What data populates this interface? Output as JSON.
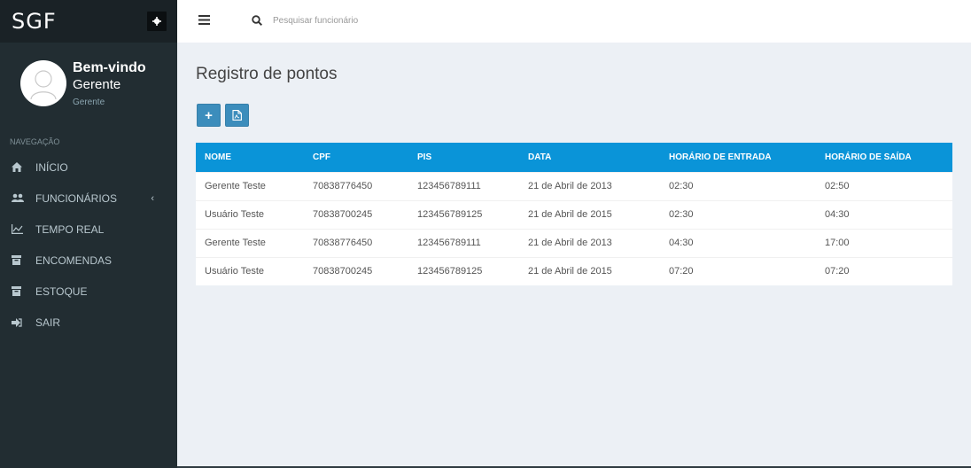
{
  "brand": {
    "name": "SGF"
  },
  "user_panel": {
    "welcome": "Bem-vindo",
    "name": "Gerente",
    "role": "Gerente"
  },
  "nav": {
    "header": "NAVEGAÇÃO",
    "items": [
      {
        "label": "INÍCIO",
        "icon": "home-icon"
      },
      {
        "label": "FUNCIONÁRIOS",
        "icon": "users-icon",
        "chevron": "‹"
      },
      {
        "label": "TEMPO REAL",
        "icon": "line-chart-icon"
      },
      {
        "label": "ENCOMENDAS",
        "icon": "box-icon"
      },
      {
        "label": "ESTOQUE",
        "icon": "box-icon"
      },
      {
        "label": "SAIR",
        "icon": "sign-out-icon"
      }
    ]
  },
  "search": {
    "placeholder": "Pesquisar funcionário"
  },
  "page": {
    "title": "Registro de pontos",
    "add_label": "+"
  },
  "table": {
    "headers": [
      "NOME",
      "CPF",
      "PIS",
      "DATA",
      "HORÁRIO DE ENTRADA",
      "HORÁRIO DE SAÍDA"
    ],
    "rows": [
      [
        "Gerente Teste",
        "70838776450",
        "123456789111",
        "21 de Abril de 2013",
        "02:30",
        "02:50"
      ],
      [
        "Usuário Teste",
        "70838700245",
        "123456789125",
        "21 de Abril de 2015",
        "02:30",
        "04:30"
      ],
      [
        "Gerente Teste",
        "70838776450",
        "123456789111",
        "21 de Abril de 2013",
        "04:30",
        "17:00"
      ],
      [
        "Usuário Teste",
        "70838700245",
        "123456789125",
        "21 de Abril de 2015",
        "07:20",
        "07:20"
      ]
    ]
  },
  "colors": {
    "sidebar": "#222d32",
    "brand_bar": "#1a2226",
    "table_header": "#0a94d8",
    "button": "#3c8dbc",
    "content_bg": "#ecf0f5"
  }
}
